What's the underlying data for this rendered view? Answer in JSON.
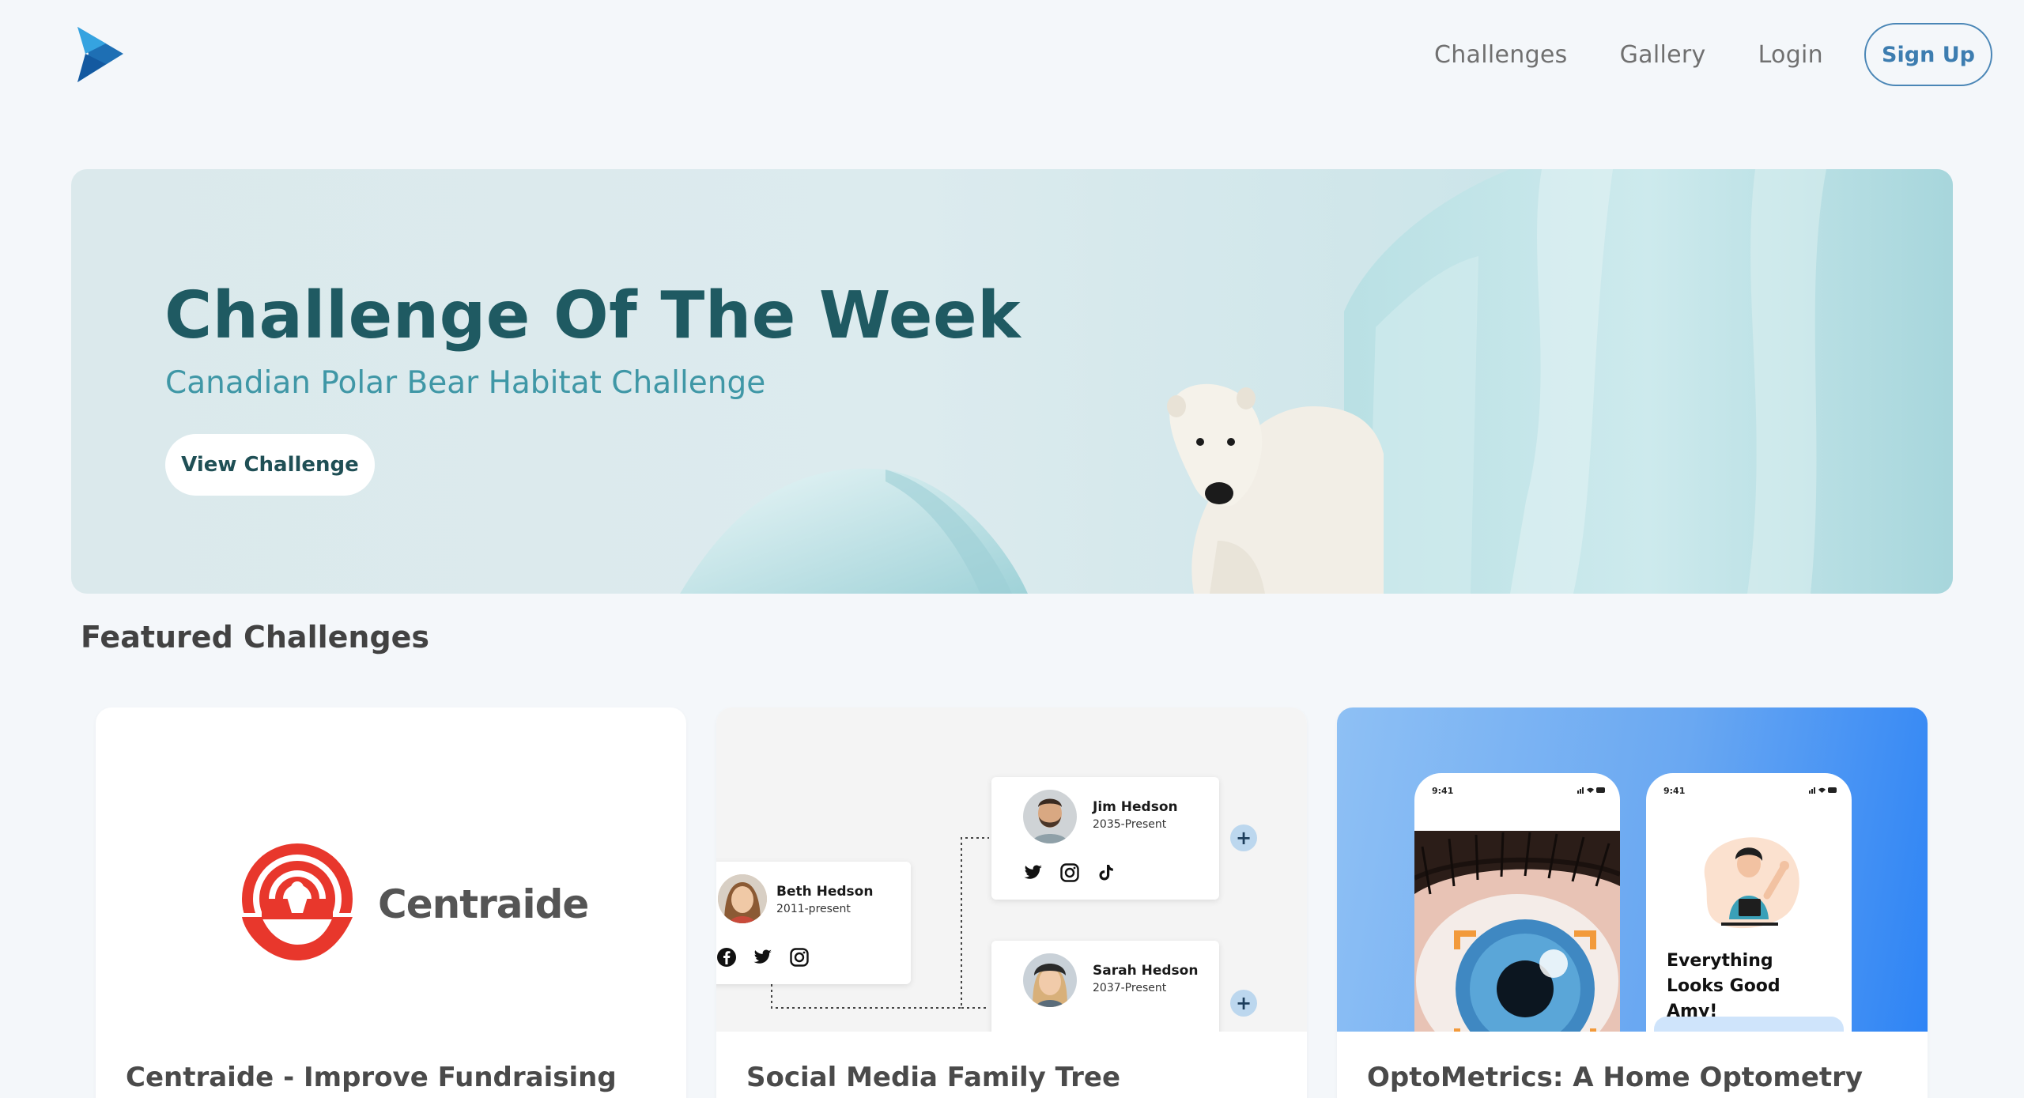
{
  "nav": {
    "logo": "arrow-logo",
    "links": [
      "Challenges",
      "Gallery",
      "Login"
    ],
    "signup_label": "Sign Up"
  },
  "hero": {
    "title": "Challenge Of The Week",
    "subtitle": "Canadian Polar Bear Habitat Challenge",
    "button_label": "View Challenge"
  },
  "featured": {
    "title": "Featured Challenges",
    "cards": [
      {
        "title": "Centraide - Improve Fundraising Through Software",
        "logo_text": "Centraide"
      },
      {
        "title": "Social Media Family Tree",
        "people": [
          {
            "name": "Beth Hedson",
            "years": "2011-present"
          },
          {
            "name": "Jim Hedson",
            "years": "2035-Present"
          },
          {
            "name": "Sarah Hedson",
            "years": "2037-Present"
          }
        ],
        "plus_label": "+"
      },
      {
        "title": "OptoMetrics: A Home Optometry App or Device",
        "phone_time": "9:41",
        "phone_message": "Everything Looks Good Amy!"
      }
    ]
  },
  "colors": {
    "accent": "#3d7db0",
    "hero_title": "#1f5a62",
    "hero_subtitle": "#3f97a6",
    "centraide_red": "#e8372c"
  }
}
